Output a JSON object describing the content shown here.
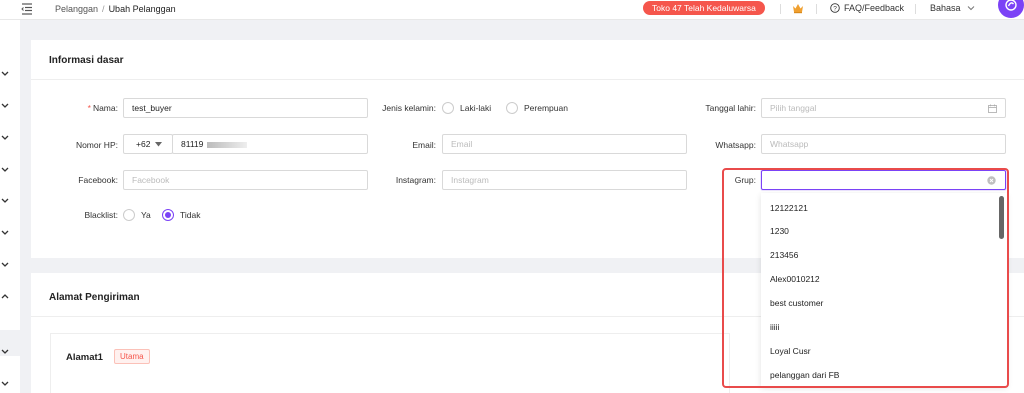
{
  "breadcrumb": {
    "parent": "Pelanggan",
    "separator": "/",
    "current": "Ubah Pelanggan"
  },
  "header": {
    "expire_badge": "Toko 47 Telah Kedaluwarsa",
    "faq": "FAQ/Feedback",
    "language": "Bahasa"
  },
  "basic_info": {
    "title": "Informasi dasar",
    "name": {
      "label": "Nama",
      "required_mark": "*",
      "value": "test_buyer"
    },
    "gender": {
      "label": "Jenis kelamin",
      "options": [
        "Laki-laki",
        "Perempuan"
      ]
    },
    "birthday": {
      "label": "Tanggal lahir",
      "placeholder": "Pilih tanggal"
    },
    "phone": {
      "label": "Nomor HP",
      "country_code": "+62",
      "value": "81119"
    },
    "email": {
      "label": "Email",
      "placeholder": "Email"
    },
    "whatsapp": {
      "label": "Whatsapp",
      "placeholder": "Whatsapp"
    },
    "facebook": {
      "label": "Facebook",
      "placeholder": "Facebook"
    },
    "instagram": {
      "label": "Instagram",
      "placeholder": "Instagram"
    },
    "group": {
      "label": "Grup",
      "value": ""
    },
    "blacklist": {
      "label": "Blacklist",
      "options": [
        "Ya",
        "Tidak"
      ],
      "selected": "Tidak"
    }
  },
  "group_dropdown": {
    "options": [
      "12122121",
      "1230",
      "213456",
      "Alex0010212",
      "best customer",
      "iiiii",
      "Loyal Cusr",
      "pelanggan dari FB"
    ]
  },
  "address": {
    "title": "Alamat Pengiriman",
    "item_title": "Alamat1",
    "main_tag": "Utama"
  },
  "colors": {
    "accent": "#7b42f6",
    "danger": "#f5564c",
    "highlight": "#e94b4b"
  }
}
